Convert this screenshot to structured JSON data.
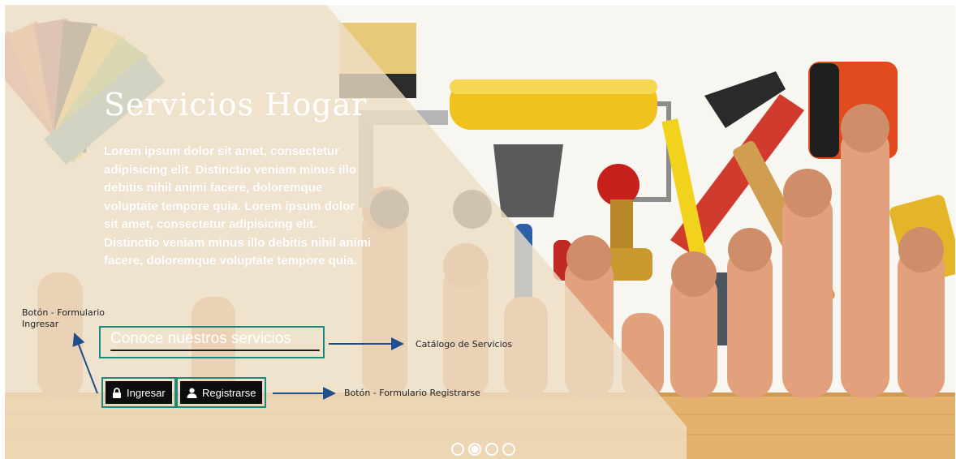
{
  "hero": {
    "title": "Servicios Hogar",
    "description": "Lorem ipsum dolor sit amet, consectetur adipisicing elit. Distinctio veniam minus illo debitis nihil animi facere, doloremque voluptate tempore quia. Lorem ipsum dolor sit amet, consectetur adipisicing elit. Distinctio veniam minus illo debitis nihil animi facere, doloremque voluptate tempore quia.",
    "cta_label": "Conoce nuestros servicios",
    "login_label": "Ingresar",
    "register_label": "Registrarse",
    "background_subject": "hands holding paint roller, hammer, pipe wrench, tape measure, spirit level, calculator, brush and color swatches",
    "overlay_color": "#eedfc5",
    "frame_color": "#1a8a7d"
  },
  "carousel": {
    "slide_count": 4,
    "active_index": 2
  },
  "annotations": {
    "login_note": "Botón - Formulario Ingresar",
    "catalog_note": "Catálogo de Servicios",
    "register_note": "Botón - Formulario Registrarse",
    "arrow_color": "#1f4e8c"
  },
  "icons": {
    "login": "lock-icon",
    "register": "user-icon"
  }
}
